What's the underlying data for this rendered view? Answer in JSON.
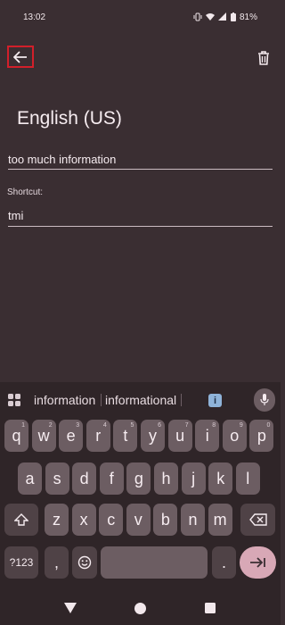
{
  "status_bar": {
    "time": "13:02",
    "battery": "81%"
  },
  "top_bar": {
    "back_icon": "arrow-left-icon",
    "delete_icon": "trash-icon"
  },
  "content": {
    "language_title": "English (US)",
    "phrase_value": "too much information",
    "shortcut_label": "Shortcut:",
    "shortcut_value": "tmi"
  },
  "keyboard": {
    "suggestions": [
      "information",
      "informational"
    ],
    "info_chip": "i",
    "row1": [
      {
        "k": "q",
        "h": "1"
      },
      {
        "k": "w",
        "h": "2"
      },
      {
        "k": "e",
        "h": "3"
      },
      {
        "k": "r",
        "h": "4"
      },
      {
        "k": "t",
        "h": "5"
      },
      {
        "k": "y",
        "h": "6"
      },
      {
        "k": "u",
        "h": "7"
      },
      {
        "k": "i",
        "h": "8"
      },
      {
        "k": "o",
        "h": "9"
      },
      {
        "k": "p",
        "h": "0"
      }
    ],
    "row2": [
      "a",
      "s",
      "d",
      "f",
      "g",
      "h",
      "j",
      "k",
      "l"
    ],
    "row3": [
      "z",
      "x",
      "c",
      "v",
      "b",
      "n",
      "m"
    ],
    "num_label": "?123",
    "comma": ",",
    "period": ".",
    "accent": "#3a2e32"
  }
}
